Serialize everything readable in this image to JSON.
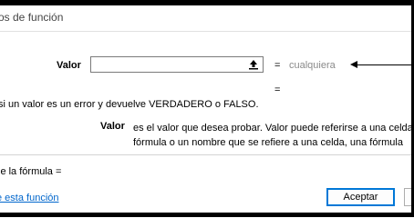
{
  "dialog": {
    "title": "os de función"
  },
  "argument": {
    "label": "Valor",
    "input_value": "",
    "equals": "=",
    "value_hint": "cualquiera"
  },
  "result": {
    "equals": "="
  },
  "function": {
    "description": "si un valor es un error y devuelve VERDADERO o FALSO."
  },
  "parameter": {
    "name": "Valor",
    "desc_line1": "es el valor que desea probar. Valor puede referirse a una celda,",
    "desc_line2": "fórmula o un nombre que se refiere a una celda, una fórmula"
  },
  "formula_result": {
    "label": "le la fórmula ="
  },
  "help": {
    "link_text": "e esta función"
  },
  "buttons": {
    "accept_label": "Aceptar",
    "cancel_label": ""
  },
  "icons": {
    "collapse": "collapse-dialog-icon",
    "arrow": "arrow-left-icon"
  }
}
